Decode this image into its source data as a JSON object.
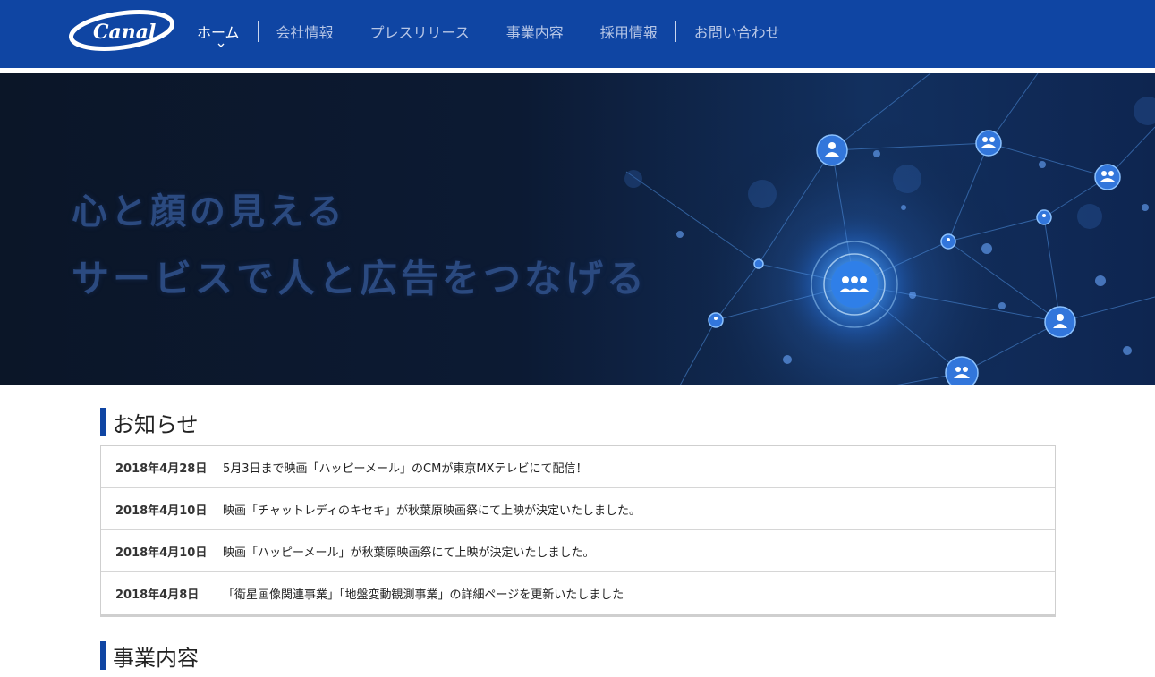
{
  "header": {
    "logo_text": "Canal",
    "nav": [
      {
        "label": "ホーム",
        "active": true
      },
      {
        "label": "会社情報",
        "active": false
      },
      {
        "label": "プレスリリース",
        "active": false
      },
      {
        "label": "事業内容",
        "active": false
      },
      {
        "label": "採用情報",
        "active": false
      },
      {
        "label": "お問い合わせ",
        "active": false
      }
    ]
  },
  "hero": {
    "line1": "心と顔の見える",
    "line2": "サービスで人と広告をつなげる"
  },
  "news": {
    "title": "お知らせ",
    "items": [
      {
        "date": "2018年4月28日",
        "text": "5月3日まで映画「ハッピーメール」のCMが東京MXテレビにて配信！"
      },
      {
        "date": "2018年4月10日",
        "text": "映画「チャットレディのキセキ」が秋葉原映画祭にて上映が決定いたしました。"
      },
      {
        "date": "2018年4月10日",
        "text": "映画「ハッピーメール」が秋葉原映画祭にて上映が決定いたしました。"
      },
      {
        "date": "2018年4月8日",
        "text": "「衛星画像関連事業」「地盤変動観測事業」の詳細ページを更新いたしました"
      }
    ]
  },
  "business": {
    "title": "事業内容"
  },
  "colors": {
    "brand": "#0f45a3",
    "hero_text": "#2b4a80",
    "hero_bg": "#0b1628"
  }
}
